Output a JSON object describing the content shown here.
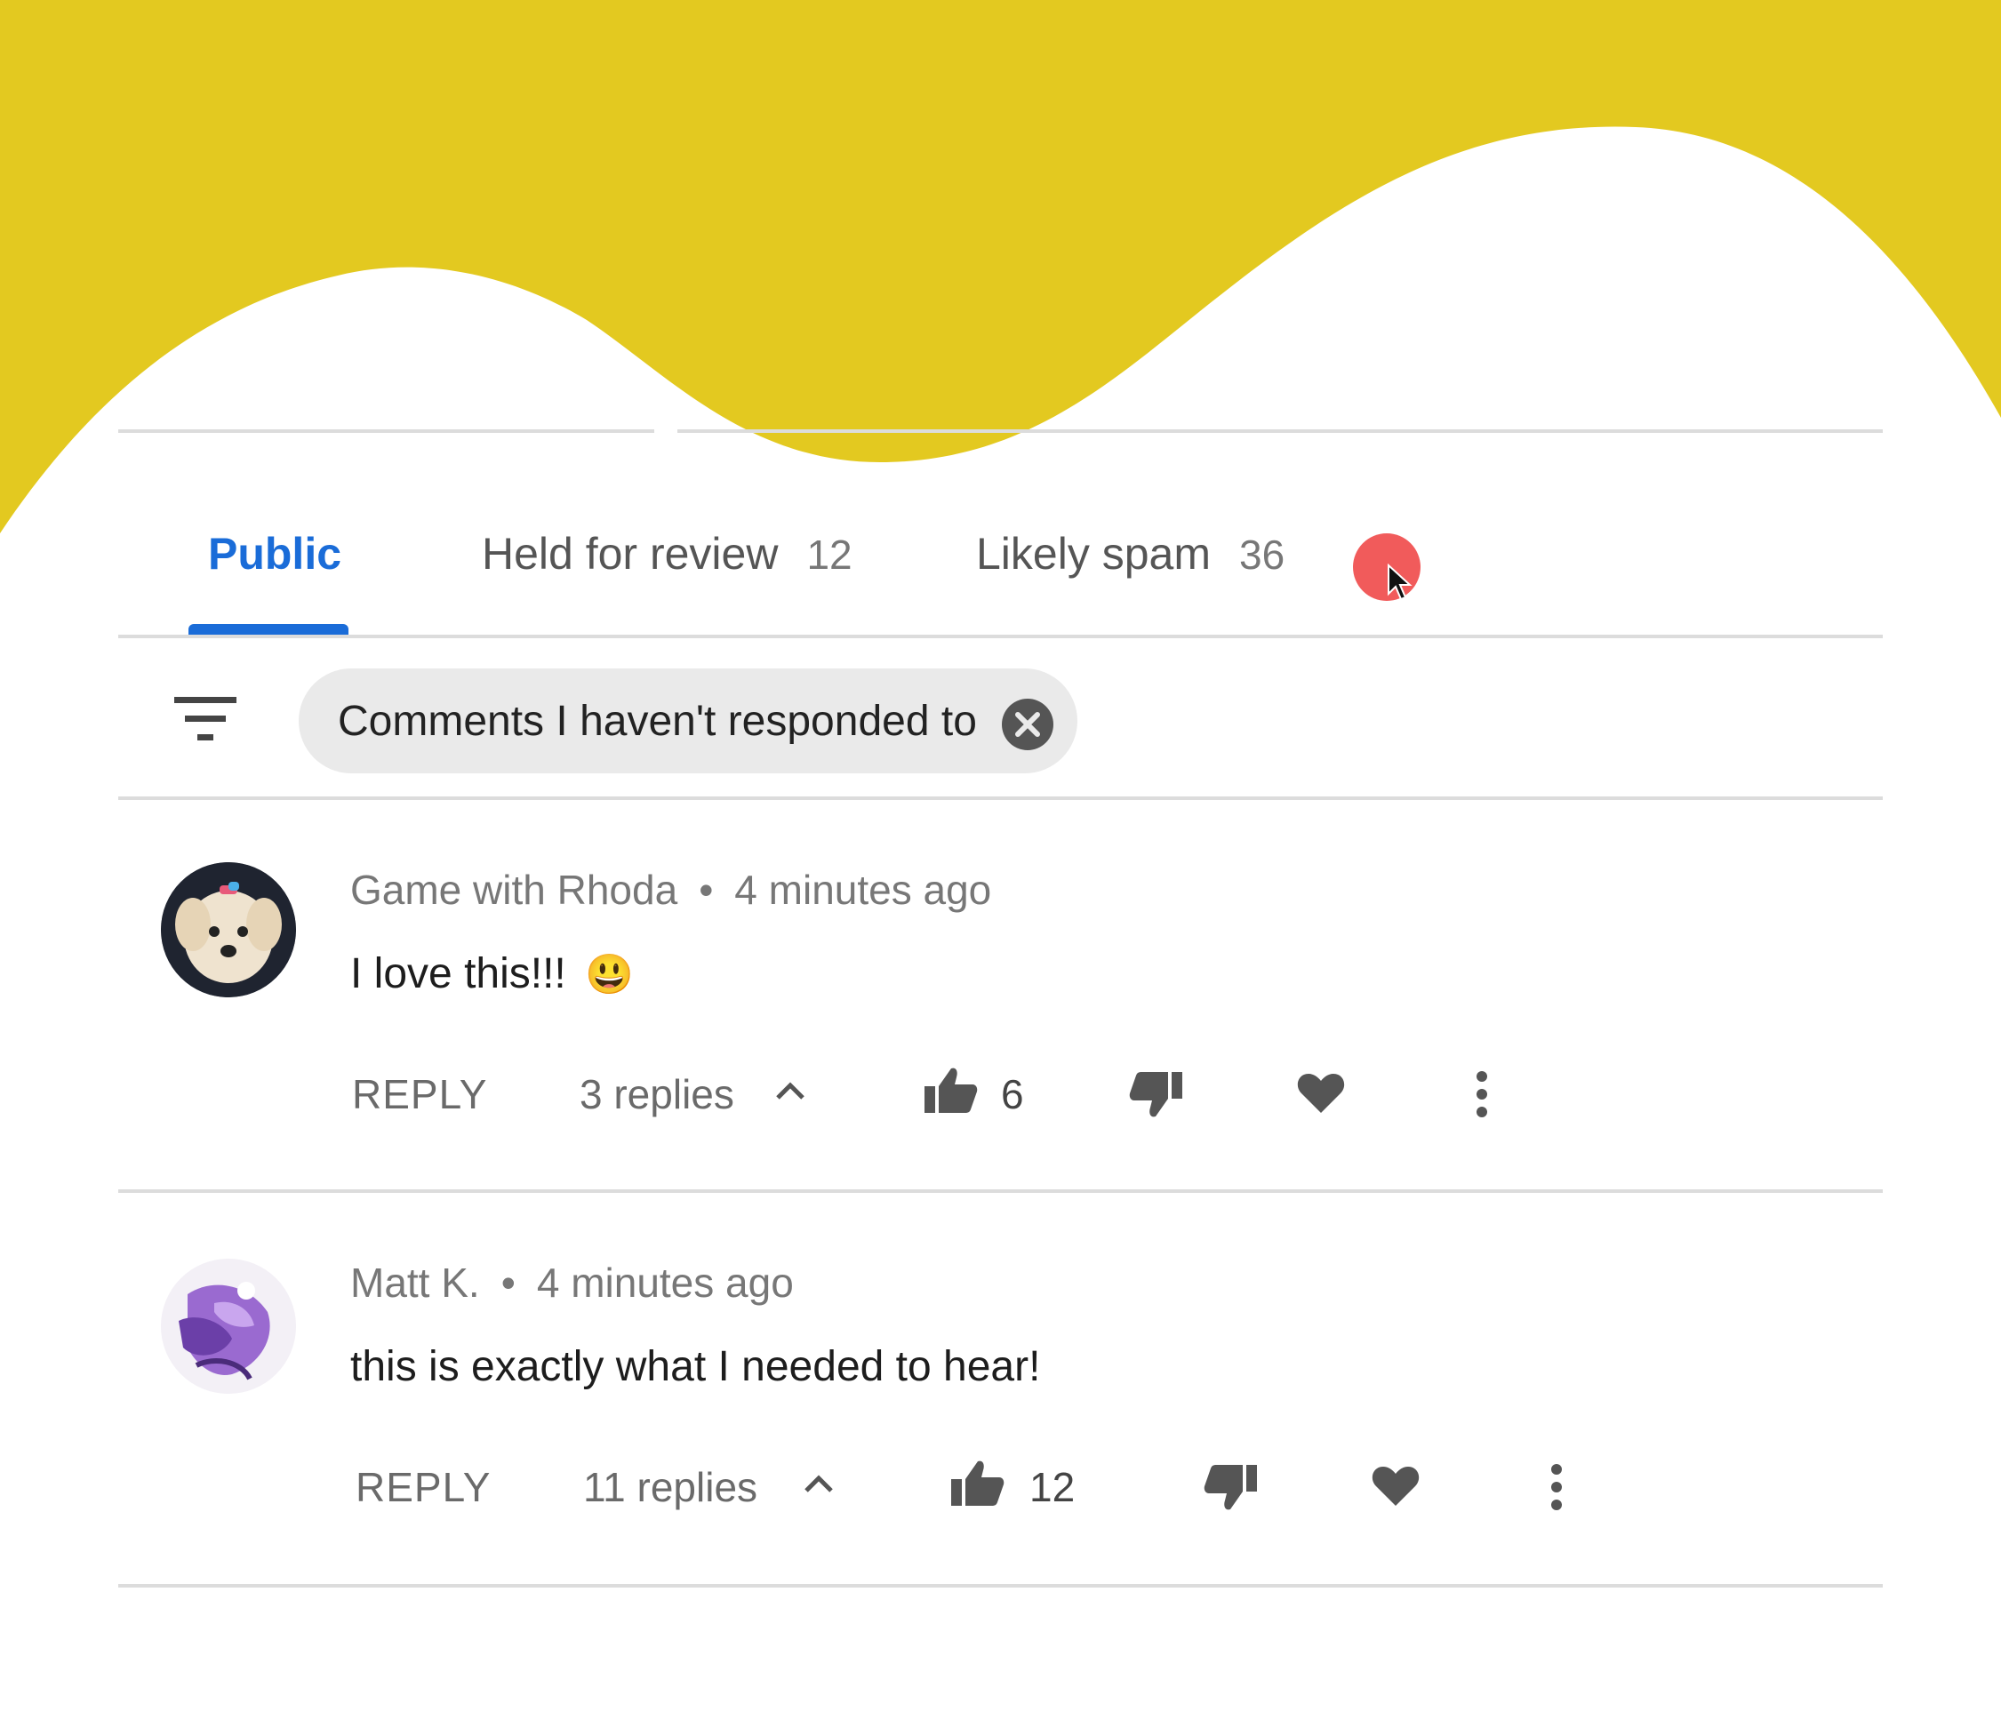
{
  "colors": {
    "banner": "#e3c920",
    "tab_active": "#1a6cd8",
    "cursor_dot": "#f15b5b"
  },
  "tabs": [
    {
      "label": "Public",
      "count": ""
    },
    {
      "label": "Held for review",
      "count": "12"
    },
    {
      "label": "Likely spam",
      "count": "36"
    }
  ],
  "filter": {
    "icon": "filter-icon",
    "chip_label": "Comments I haven't responded to",
    "chip_close_icon": "close-circle-icon"
  },
  "comments": [
    {
      "author": "Game with Rhoda",
      "separator": "•",
      "time": "4 minutes ago",
      "text": "I love this!!!",
      "emoji": "😃",
      "reply_label": "REPLY",
      "replies_label": "3 replies",
      "likes": "6"
    },
    {
      "author": "Matt K.",
      "separator": "•",
      "time": "4 minutes ago",
      "text": "this is exactly what I needed to hear!",
      "reply_label": "REPLY",
      "replies_label": "11 replies",
      "likes": "12"
    }
  ]
}
